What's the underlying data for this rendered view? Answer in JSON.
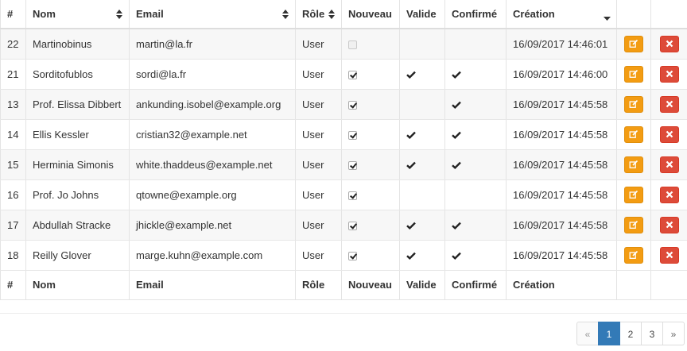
{
  "columns": {
    "id": "#",
    "name": "Nom",
    "email": "Email",
    "role": "Rôle",
    "new": "Nouveau",
    "valid": "Valide",
    "confirmed": "Confirmé",
    "created": "Création"
  },
  "rows": [
    {
      "id": "22",
      "name": "Martinobinus",
      "email": "martin@la.fr",
      "role": "User",
      "new": false,
      "valid": false,
      "confirmed": false,
      "created": "16/09/2017 14:46:01"
    },
    {
      "id": "21",
      "name": "Sorditofublos",
      "email": "sordi@la.fr",
      "role": "User",
      "new": true,
      "valid": true,
      "confirmed": true,
      "created": "16/09/2017 14:46:00"
    },
    {
      "id": "13",
      "name": "Prof. Elissa Dibbert",
      "email": "ankunding.isobel@example.org",
      "role": "User",
      "new": true,
      "valid": false,
      "confirmed": true,
      "created": "16/09/2017 14:45:58"
    },
    {
      "id": "14",
      "name": "Ellis Kessler",
      "email": "cristian32@example.net",
      "role": "User",
      "new": true,
      "valid": true,
      "confirmed": true,
      "created": "16/09/2017 14:45:58"
    },
    {
      "id": "15",
      "name": "Herminia Simonis",
      "email": "white.thaddeus@example.net",
      "role": "User",
      "new": true,
      "valid": true,
      "confirmed": true,
      "created": "16/09/2017 14:45:58"
    },
    {
      "id": "16",
      "name": "Prof. Jo Johns",
      "email": "qtowne@example.org",
      "role": "User",
      "new": true,
      "valid": false,
      "confirmed": false,
      "created": "16/09/2017 14:45:58"
    },
    {
      "id": "17",
      "name": "Abdullah Stracke",
      "email": "jhickle@example.net",
      "role": "User",
      "new": true,
      "valid": true,
      "confirmed": true,
      "created": "16/09/2017 14:45:58"
    },
    {
      "id": "18",
      "name": "Reilly Glover",
      "email": "marge.kuhn@example.com",
      "role": "User",
      "new": true,
      "valid": true,
      "confirmed": true,
      "created": "16/09/2017 14:45:58"
    }
  ],
  "pagination": {
    "prev": "«",
    "pages": [
      "1",
      "2",
      "3"
    ],
    "active_page": "1",
    "next": "»"
  },
  "icons": {
    "sort": "sort-icon",
    "sort_desc": "sort-desc-icon",
    "checkmark": "check-icon",
    "edit": "edit-icon",
    "delete": "delete-icon"
  },
  "colors": {
    "edit_button": "#f39c12",
    "delete_button": "#dd4b39",
    "active_page": "#337ab7",
    "striped_row": "#f7f7f7"
  }
}
